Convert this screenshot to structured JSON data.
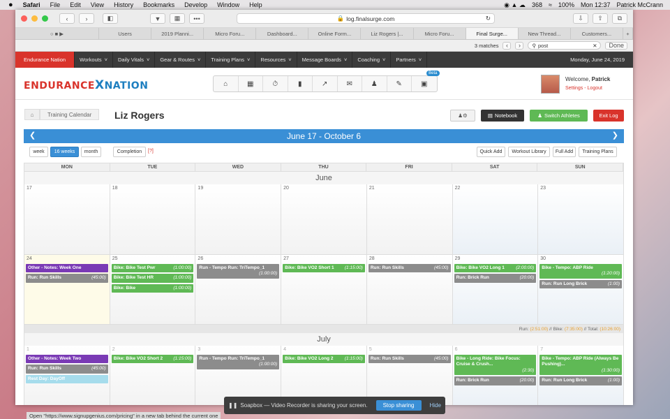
{
  "macmenu": {
    "apple": "",
    "app": "Safari",
    "items": [
      "File",
      "Edit",
      "View",
      "History",
      "Bookmarks",
      "Develop",
      "Window",
      "Help"
    ],
    "badge": "368",
    "battery": "100%",
    "clock": "Mon 12:37",
    "user": "Patrick McCrann"
  },
  "browser": {
    "url": "log.finalsurge.com",
    "tabs": [
      "Users",
      "2019 Planni...",
      "Micro Foru...",
      "Dashboard...",
      "Online Form...",
      "Liz Rogers |...",
      "Micro Foru...",
      "Final Surge...",
      "New Thread...",
      "Customers..."
    ],
    "active_tab": 7,
    "find": {
      "matches": "3 matches",
      "query": "post",
      "done": "Done"
    }
  },
  "nav": {
    "items": [
      "Endurance Nation",
      "Workouts",
      "Daily Vitals",
      "Gear & Routes",
      "Training Plans",
      "Resources",
      "Message Boards",
      "Coaching",
      "Partners"
    ],
    "date": "Monday, June 24, 2019"
  },
  "header": {
    "logo_a": "ENDURANCE",
    "logo_x": "X",
    "logo_b": "NATION",
    "beta": "Beta",
    "welcome": "Welcome,",
    "user": "Patrick",
    "settings": "Settings",
    "logout": "Logout"
  },
  "page": {
    "breadcrumb": "Training Calendar",
    "title": "Liz Rogers",
    "notebook": "Notebook",
    "switch": "Switch Athletes",
    "exit": "Exit Log"
  },
  "calendar": {
    "range": "June 17 - October 6",
    "views": [
      "week",
      "16 weeks",
      "month"
    ],
    "completion": "Completion",
    "help": "[?]",
    "actions": [
      "Quick Add",
      "Workout Library",
      "Full Add",
      "Training Plans"
    ],
    "days": [
      "MON",
      "TUE",
      "WED",
      "THU",
      "FRI",
      "SAT",
      "SUN"
    ],
    "month1": "June",
    "month2": "July",
    "week1": [
      "17",
      "18",
      "19",
      "20",
      "21",
      "22",
      "23"
    ],
    "week2": {
      "nums": [
        "24",
        "25",
        "26",
        "27",
        "28",
        "29",
        "30"
      ],
      "mon": [
        {
          "t": "Other - Notes: Week One",
          "d": ""
        },
        {
          "t": "Run: Run Skills",
          "d": "(45:00)"
        }
      ],
      "tue": [
        {
          "t": "Bike: Bike Test Pwr",
          "d": "(1:00:00)"
        },
        {
          "t": "Bike: Bike Test HR",
          "d": "(1:00:00)"
        },
        {
          "t": "Bike: Bike",
          "d": "(1:00:00)"
        }
      ],
      "wed": [
        {
          "t": "Run - Tempo Run: TriTempo_1",
          "d": "(1:00:00)"
        }
      ],
      "thu": [
        {
          "t": "Bike: Bike VO2 Short 1",
          "d": "(1:15:00)"
        }
      ],
      "fri": [
        {
          "t": "Run: Run Skills",
          "d": "(45:00)"
        }
      ],
      "sat": [
        {
          "t": "Bike: Bike VO2 Long 1",
          "d": "(2:00:00)"
        },
        {
          "t": "Run: Brick Run",
          "d": "(20:00)"
        }
      ],
      "sun": [
        {
          "t": "Bike - Tempo: ABP Ride",
          "d": "(1:20:00)"
        },
        {
          "t": "Run: Run Long Brick",
          "d": "(1:00)"
        }
      ]
    },
    "totals": {
      "run_l": "Run:",
      "run": "(2:51:00)",
      "bike_l": "// Bike:",
      "bike": "(7:35:00)",
      "total_l": "// Total:",
      "total": "(10:26:00)"
    },
    "week3": {
      "nums": [
        "1",
        "2",
        "3",
        "4",
        "5",
        "6",
        "7"
      ],
      "mon": [
        {
          "t": "Other - Notes: Week Two",
          "d": ""
        },
        {
          "t": "Run: Run Skills",
          "d": "(45:00)"
        },
        {
          "t": "Rest Day: DayOff",
          "d": ""
        }
      ],
      "tue": [
        {
          "t": "Bike: Bike VO2 Short 2",
          "d": "(1:15:00)"
        }
      ],
      "wed": [
        {
          "t": "Run - Tempo Run: TriTempo_1",
          "d": "(1:00:00)"
        }
      ],
      "thu": [
        {
          "t": "Bike: Bike VO2 Long 2",
          "d": "(1:15:00)"
        }
      ],
      "fri": [
        {
          "t": "Run: Run Skills",
          "d": "(45:00)"
        }
      ],
      "sat": [
        {
          "t": "Bike - Long Ride: Bike Focus: Cruise & Crush...",
          "d": "(2:30)"
        },
        {
          "t": "Run: Brick Run",
          "d": "(20:00)"
        }
      ],
      "sun": [
        {
          "t": "Bike - Tempo: ABP Ride (Always Be Pushing)...",
          "d": "(1:30:00)"
        },
        {
          "t": "Run: Run Long Brick",
          "d": "(1:00)"
        }
      ]
    }
  },
  "share": {
    "msg": "Soapbox — Video Recorder is sharing your screen.",
    "stop": "Stop sharing",
    "hide": "Hide"
  },
  "statusbar": "Open \"https://www.signupgenius.com/pricing\" in a new tab behind the current one"
}
